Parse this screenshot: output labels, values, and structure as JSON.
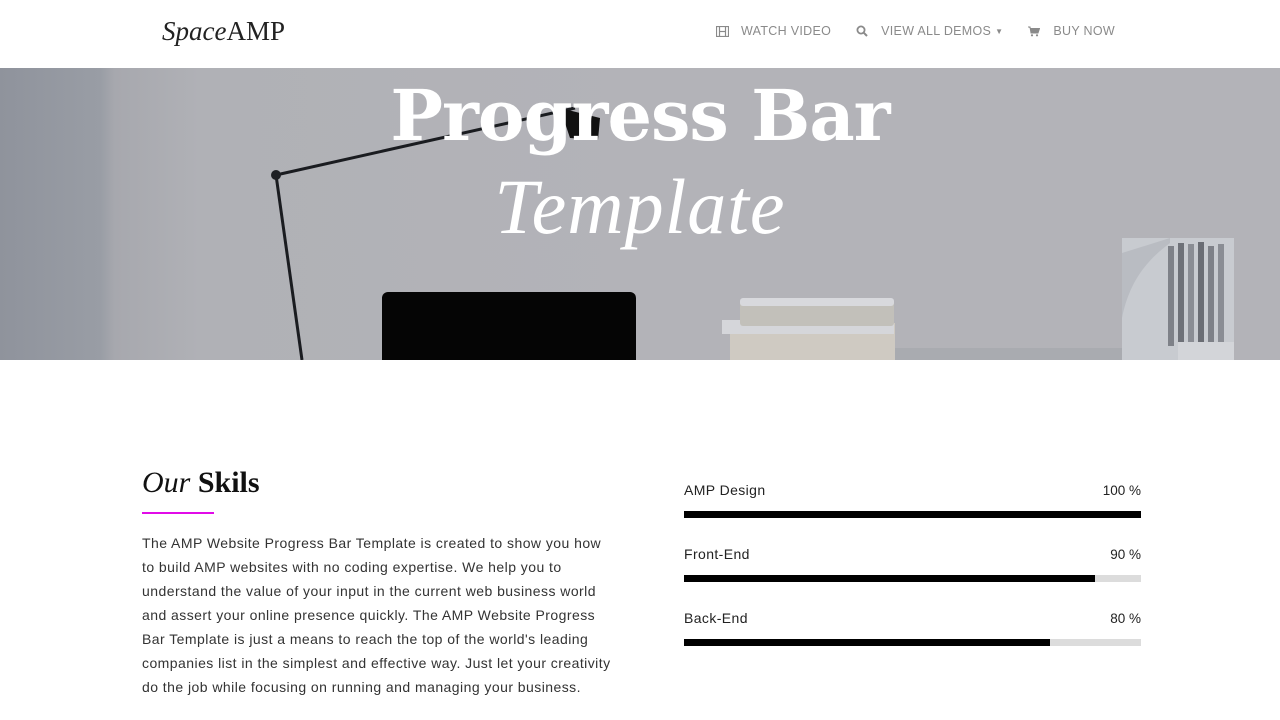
{
  "header": {
    "logo_italic": "Space",
    "logo_regular": "AMP",
    "nav": [
      {
        "label": "WATCH VIDEO",
        "icon": "film-icon"
      },
      {
        "label": "VIEW ALL DEMOS",
        "icon": "search-icon",
        "has_dropdown": true
      },
      {
        "label": "BUY NOW",
        "icon": "cart-icon"
      }
    ]
  },
  "hero": {
    "title": "Progress Bar",
    "subtitle": "Template"
  },
  "skills": {
    "heading_italic": "Our",
    "heading_bold": "Skils",
    "accent_color": "#e10be8",
    "paragraph": "The AMP Website Progress Bar Template is created to show you how to build AMP websites with no coding expertise. We help you to understand the value of your input in the current web business world and assert your online presence quickly. The AMP Website Progress Bar Template is just a means to reach the top of the world's leading companies list in the simplest and effective way. Just let your creativity do the job while focusing on running and managing your business.",
    "bars": [
      {
        "label": "AMP Design",
        "value_text": "100 %",
        "percent": 100
      },
      {
        "label": "Front-End",
        "value_text": "90 %",
        "percent": 90
      },
      {
        "label": "Back-End",
        "value_text": "80 %",
        "percent": 80
      }
    ]
  }
}
